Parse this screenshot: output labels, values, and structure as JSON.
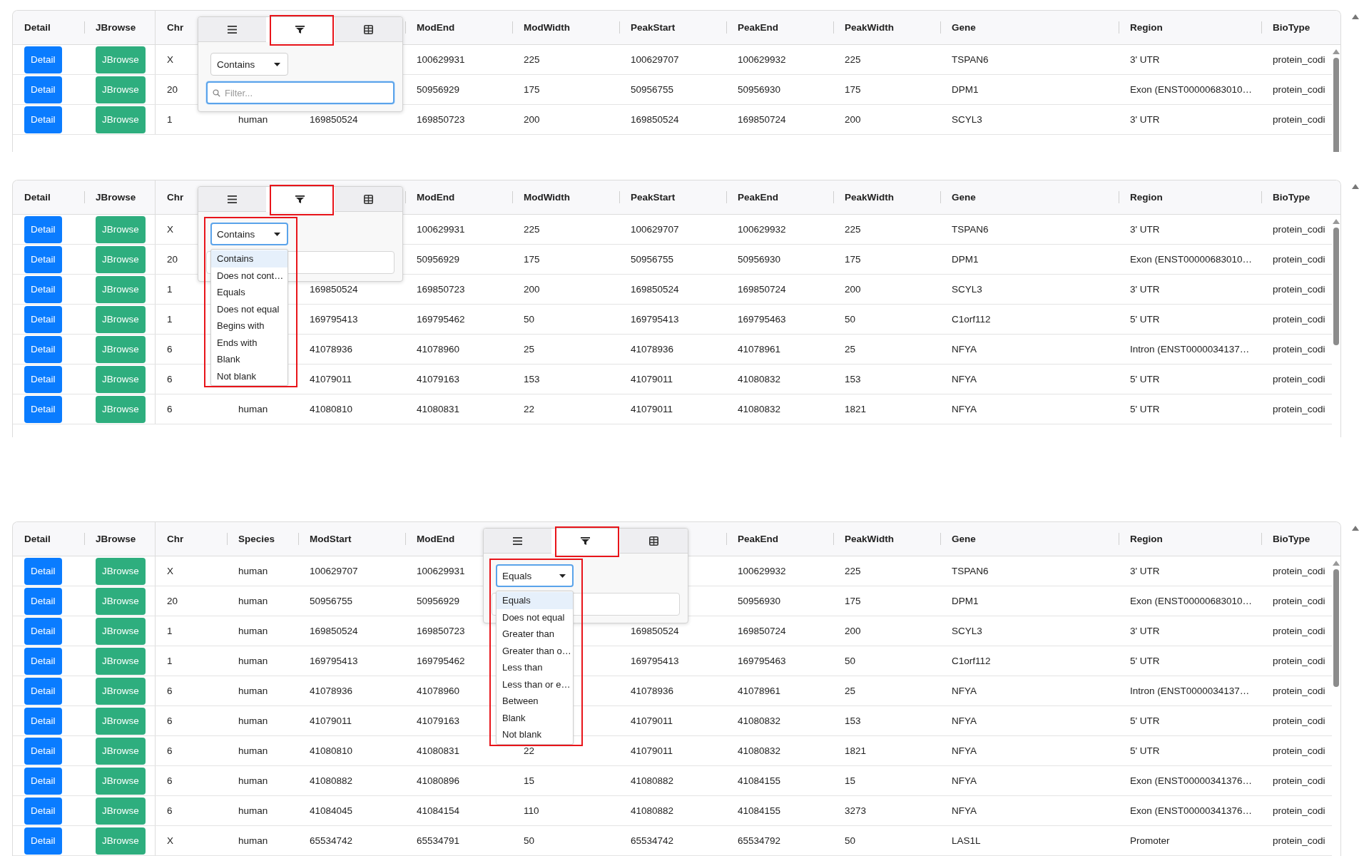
{
  "panels": [
    {
      "columns": [
        {
          "label": "Detail",
          "kind": "primary"
        },
        {
          "label": "JBrowse",
          "kind": "success"
        },
        {
          "label": "Chr",
          "kind": "text"
        },
        {
          "kind": "text"
        },
        {
          "kind": "text"
        },
        {
          "label": "ModEnd",
          "kind": "text"
        },
        {
          "label": "ModWidth",
          "kind": "text"
        },
        {
          "label": "PeakStart",
          "kind": "text"
        },
        {
          "label": "PeakEnd",
          "kind": "text"
        },
        {
          "label": "PeakWidth",
          "kind": "text"
        },
        {
          "label": "Gene",
          "kind": "text"
        },
        {
          "label": "Region",
          "kind": "text"
        },
        {
          "label": "BioType",
          "kind": "text"
        }
      ],
      "rows": [
        [
          "Detail",
          "JBrowse",
          "X",
          null,
          null,
          "100629931",
          "225",
          "100629707",
          "100629932",
          "225",
          "TSPAN6",
          "3' UTR",
          "protein_codi"
        ],
        [
          "Detail",
          "JBrowse",
          "20",
          null,
          null,
          "50956929",
          "175",
          "50956755",
          "50956930",
          "175",
          "DPM1",
          "Exon (ENST00000683010…",
          "protein_codi"
        ],
        [
          "Detail",
          "JBrowse",
          "1",
          "human",
          "169850524",
          "169850723",
          "200",
          "169850524",
          "169850724",
          "200",
          "SCYL3",
          "3' UTR",
          "protein_codi"
        ]
      ],
      "popup": {
        "tabs": [
          {
            "kind": "menu",
            "selected": false,
            "highlighted": false
          },
          {
            "kind": "filter",
            "selected": true,
            "highlighted": true
          },
          {
            "kind": "columns",
            "selected": false,
            "highlighted": false
          }
        ],
        "operator": {
          "value": "Contains",
          "focused": false
        },
        "filter": {
          "placeholder": "Filter...",
          "focused": true
        }
      }
    },
    {
      "columns": [
        {
          "label": "Detail",
          "kind": "primary"
        },
        {
          "label": "JBrowse",
          "kind": "success"
        },
        {
          "label": "Chr",
          "kind": "text"
        },
        {
          "kind": "text"
        },
        {
          "kind": "text"
        },
        {
          "label": "ModEnd",
          "kind": "text"
        },
        {
          "label": "ModWidth",
          "kind": "text"
        },
        {
          "label": "PeakStart",
          "kind": "text"
        },
        {
          "label": "PeakEnd",
          "kind": "text"
        },
        {
          "label": "PeakWidth",
          "kind": "text"
        },
        {
          "label": "Gene",
          "kind": "text"
        },
        {
          "label": "Region",
          "kind": "text"
        },
        {
          "label": "BioType",
          "kind": "text"
        }
      ],
      "rows": [
        [
          "Detail",
          "JBrowse",
          "X",
          null,
          null,
          "100629931",
          "225",
          "100629707",
          "100629932",
          "225",
          "TSPAN6",
          "3' UTR",
          "protein_codi"
        ],
        [
          "Detail",
          "JBrowse",
          "20",
          null,
          null,
          "50956929",
          "175",
          "50956755",
          "50956930",
          "175",
          "DPM1",
          "Exon (ENST00000683010…",
          "protein_codi"
        ],
        [
          "Detail",
          "JBrowse",
          "1",
          null,
          "169850524",
          "169850723",
          "200",
          "169850524",
          "169850724",
          "200",
          "SCYL3",
          "3' UTR",
          "protein_codi"
        ],
        [
          "Detail",
          "JBrowse",
          "1",
          null,
          "169795413",
          "169795462",
          "50",
          "169795413",
          "169795463",
          "50",
          "C1orf112",
          "5' UTR",
          "protein_codi"
        ],
        [
          "Detail",
          "JBrowse",
          "6",
          null,
          "41078936",
          "41078960",
          "25",
          "41078936",
          "41078961",
          "25",
          "NFYA",
          "Intron (ENST0000034137…",
          "protein_codi"
        ],
        [
          "Detail",
          "JBrowse",
          "6",
          null,
          "41079011",
          "41079163",
          "153",
          "41079011",
          "41080832",
          "153",
          "NFYA",
          "5' UTR",
          "protein_codi"
        ],
        [
          "Detail",
          "JBrowse",
          "6",
          "human",
          "41080810",
          "41080831",
          "22",
          "41079011",
          "41080832",
          "1821",
          "NFYA",
          "5' UTR",
          "protein_codi"
        ]
      ],
      "popup": {
        "tabs": [
          {
            "kind": "menu",
            "selected": false,
            "highlighted": false
          },
          {
            "kind": "filter",
            "selected": true,
            "highlighted": true
          },
          {
            "kind": "columns",
            "selected": false,
            "highlighted": false
          }
        ],
        "operator": {
          "value": "Contains",
          "focused": true,
          "open": true,
          "highlighted": true
        },
        "options": [
          {
            "label": "Contains",
            "selected": true
          },
          {
            "label": "Does not cont…",
            "selected": false
          },
          {
            "label": "Equals",
            "selected": false
          },
          {
            "label": "Does not equal",
            "selected": false
          },
          {
            "label": "Begins with",
            "selected": false
          },
          {
            "label": "Ends with",
            "selected": false
          },
          {
            "label": "Blank",
            "selected": false
          },
          {
            "label": "Not blank",
            "selected": false
          }
        ],
        "filter": {
          "focused": false
        }
      }
    },
    {
      "columns": [
        {
          "label": "Detail",
          "kind": "primary"
        },
        {
          "label": "JBrowse",
          "kind": "success"
        },
        {
          "label": "Chr",
          "kind": "text"
        },
        {
          "label": "Species",
          "kind": "text"
        },
        {
          "label": "ModStart",
          "kind": "text"
        },
        {
          "label": "ModEnd",
          "kind": "text"
        },
        {
          "kind": "text"
        },
        {
          "kind": "text"
        },
        {
          "label": "PeakEnd",
          "kind": "text"
        },
        {
          "label": "PeakWidth",
          "kind": "text"
        },
        {
          "label": "Gene",
          "kind": "text"
        },
        {
          "label": "Region",
          "kind": "text"
        },
        {
          "label": "BioType",
          "kind": "text"
        }
      ],
      "rows": [
        [
          "Detail",
          "JBrowse",
          "X",
          "human",
          "100629707",
          "100629931",
          null,
          null,
          "100629932",
          "225",
          "TSPAN6",
          "3' UTR",
          "protein_codi"
        ],
        [
          "Detail",
          "JBrowse",
          "20",
          "human",
          "50956755",
          "50956929",
          null,
          null,
          "50956930",
          "175",
          "DPM1",
          "Exon (ENST00000683010…",
          "protein_codi"
        ],
        [
          "Detail",
          "JBrowse",
          "1",
          "human",
          "169850524",
          "169850723",
          null,
          "169850524",
          "169850724",
          "200",
          "SCYL3",
          "3' UTR",
          "protein_codi"
        ],
        [
          "Detail",
          "JBrowse",
          "1",
          "human",
          "169795413",
          "169795462",
          null,
          "169795413",
          "169795463",
          "50",
          "C1orf112",
          "5' UTR",
          "protein_codi"
        ],
        [
          "Detail",
          "JBrowse",
          "6",
          "human",
          "41078936",
          "41078960",
          null,
          "41078936",
          "41078961",
          "25",
          "NFYA",
          "Intron (ENST0000034137…",
          "protein_codi"
        ],
        [
          "Detail",
          "JBrowse",
          "6",
          "human",
          "41079011",
          "41079163",
          null,
          "41079011",
          "41080832",
          "153",
          "NFYA",
          "5' UTR",
          "protein_codi"
        ],
        [
          "Detail",
          "JBrowse",
          "6",
          "human",
          "41080810",
          "41080831",
          "22",
          "41079011",
          "41080832",
          "1821",
          "NFYA",
          "5' UTR",
          "protein_codi"
        ],
        [
          "Detail",
          "JBrowse",
          "6",
          "human",
          "41080882",
          "41080896",
          "15",
          "41080882",
          "41084155",
          "15",
          "NFYA",
          "Exon (ENST00000341376…",
          "protein_codi"
        ],
        [
          "Detail",
          "JBrowse",
          "6",
          "human",
          "41084045",
          "41084154",
          "110",
          "41080882",
          "41084155",
          "3273",
          "NFYA",
          "Exon (ENST00000341376…",
          "protein_codi"
        ],
        [
          "Detail",
          "JBrowse",
          "X",
          "human",
          "65534742",
          "65534791",
          "50",
          "65534742",
          "65534792",
          "50",
          "LAS1L",
          "Promoter",
          "protein_codi"
        ]
      ],
      "popup": {
        "tabs": [
          {
            "kind": "menu",
            "selected": false,
            "highlighted": false
          },
          {
            "kind": "filter",
            "selected": true,
            "highlighted": true
          },
          {
            "kind": "columns",
            "selected": false,
            "highlighted": false
          }
        ],
        "operator": {
          "value": "Equals",
          "focused": true,
          "open": true,
          "highlighted": true
        },
        "options": [
          {
            "label": "Equals",
            "selected": true
          },
          {
            "label": "Does not equal",
            "selected": false
          },
          {
            "label": "Greater than",
            "selected": false
          },
          {
            "label": "Greater than o…",
            "selected": false
          },
          {
            "label": "Less than",
            "selected": false
          },
          {
            "label": "Less than or e…",
            "selected": false
          },
          {
            "label": "Between",
            "selected": false
          },
          {
            "label": "Blank",
            "selected": false
          },
          {
            "label": "Not blank",
            "selected": false
          }
        ],
        "filter": {
          "focused": false
        }
      }
    }
  ]
}
